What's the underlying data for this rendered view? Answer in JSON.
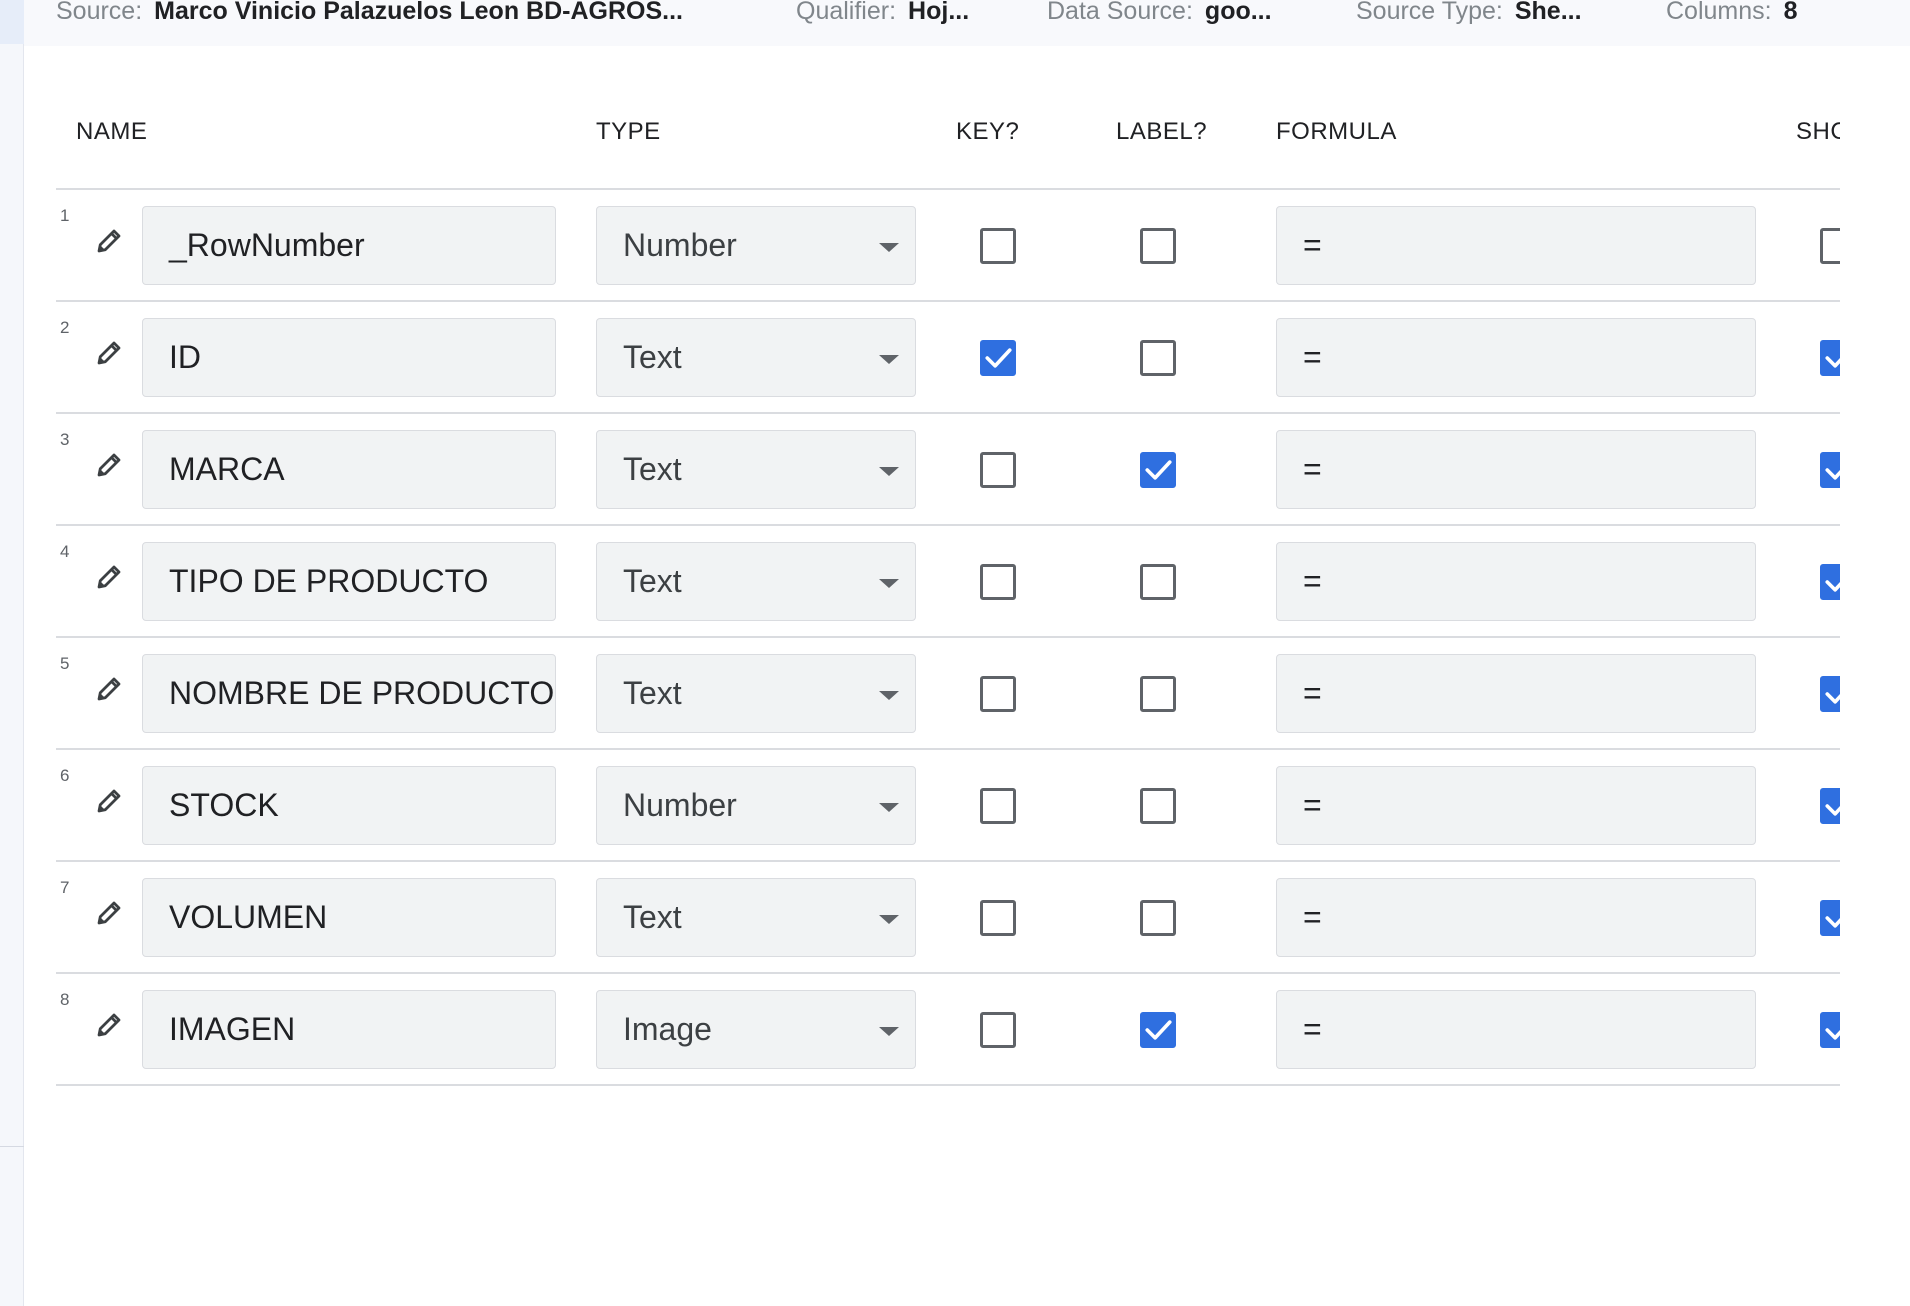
{
  "info_bar": {
    "source_label": "Source:",
    "source_value": "Marco Vinicio Palazuelos Leon BD-AGROS...",
    "qualifier_label": "Qualifier:",
    "qualifier_value": "Hoj...",
    "data_source_label": "Data Source:",
    "data_source_value": "goo...",
    "source_type_label": "Source Type:",
    "source_type_value": "She...",
    "columns_label": "Columns:",
    "columns_value": "8"
  },
  "table": {
    "headers": {
      "name": "NAME",
      "type": "TYPE",
      "key": "KEY?",
      "label": "LABEL?",
      "formula": "FORMULA",
      "show": "SHC"
    },
    "rows": [
      {
        "num": "1",
        "name": "_RowNumber",
        "type": "Number",
        "key": false,
        "label": false,
        "formula": "=",
        "show": false
      },
      {
        "num": "2",
        "name": "ID",
        "type": "Text",
        "key": true,
        "label": false,
        "formula": "=",
        "show": true
      },
      {
        "num": "3",
        "name": "MARCA",
        "type": "Text",
        "key": false,
        "label": true,
        "formula": "=",
        "show": true
      },
      {
        "num": "4",
        "name": "TIPO DE PRODUCTO",
        "type": "Text",
        "key": false,
        "label": false,
        "formula": "=",
        "show": true
      },
      {
        "num": "5",
        "name": "NOMBRE DE PRODUCTO",
        "type": "Text",
        "key": false,
        "label": false,
        "formula": "=",
        "show": true
      },
      {
        "num": "6",
        "name": "STOCK",
        "type": "Number",
        "key": false,
        "label": false,
        "formula": "=",
        "show": true
      },
      {
        "num": "7",
        "name": "VOLUMEN",
        "type": "Text",
        "key": false,
        "label": false,
        "formula": "=",
        "show": true
      },
      {
        "num": "8",
        "name": "IMAGEN",
        "type": "Image",
        "key": false,
        "label": true,
        "formula": "=",
        "show": true
      }
    ]
  },
  "icons": {
    "edit": "pencil-icon",
    "dropdown": "caret-down-icon",
    "check": "checkmark-icon"
  },
  "colors": {
    "accent": "#2f6fe0",
    "field_bg": "#f1f3f4",
    "divider": "#dadce0"
  }
}
